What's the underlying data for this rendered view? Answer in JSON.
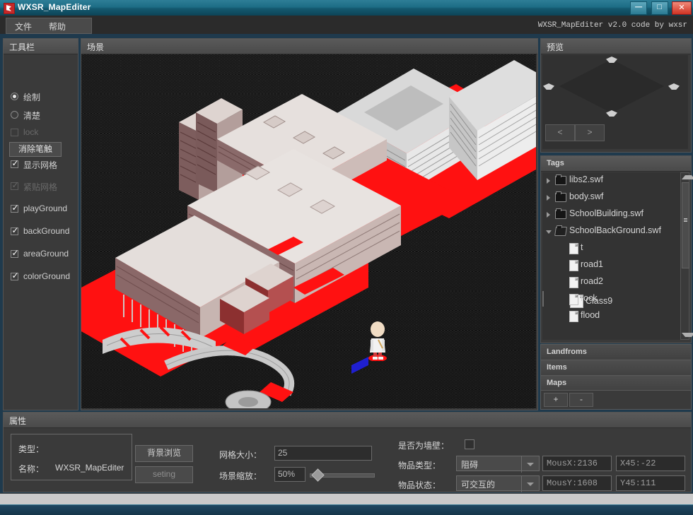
{
  "window": {
    "title": "WXSR_MapEditer",
    "icon": "app-icon",
    "minimize": "─",
    "maximize": "□",
    "close": "✕"
  },
  "menubar": {
    "file": "文件",
    "help": "帮助",
    "version_info": "WXSR_MapEditer  v2.0  code by wxsr"
  },
  "toolbar": {
    "title": "工具栏",
    "options": [
      {
        "label": "绘制",
        "type": "radio",
        "checked": true,
        "dim": false
      },
      {
        "label": "清楚",
        "type": "radio",
        "checked": false,
        "dim": false
      },
      {
        "label": "lock",
        "type": "checkbox",
        "checked": false,
        "dim": true
      }
    ],
    "clear_stroke_button": "消除笔触",
    "layers": [
      {
        "label": "显示网格",
        "checked": true,
        "dim": false
      },
      {
        "label": "紧贴网格",
        "checked": true,
        "dim": true
      },
      {
        "label": "playGround",
        "checked": true,
        "dim": false
      },
      {
        "label": "backGround",
        "checked": true,
        "dim": false
      },
      {
        "label": "areaGround",
        "checked": true,
        "dim": false
      },
      {
        "label": "colorGround",
        "checked": true,
        "dim": false
      }
    ]
  },
  "scene": {
    "title": "场景"
  },
  "preview": {
    "title": "预览",
    "prev_button": "<",
    "next_button": ">"
  },
  "tags": {
    "title": "Tags",
    "items": [
      {
        "label": "libs2.swf",
        "type": "folder",
        "expanded": false,
        "indent": 0,
        "selected": false
      },
      {
        "label": "body.swf",
        "type": "folder",
        "expanded": false,
        "indent": 0,
        "selected": false
      },
      {
        "label": "SchoolBuilding.swf",
        "type": "folder",
        "expanded": false,
        "indent": 0,
        "selected": false
      },
      {
        "label": "SchoolBackGround.swf",
        "type": "folder",
        "expanded": true,
        "indent": 0,
        "selected": false
      },
      {
        "label": "t",
        "type": "file",
        "indent": 1,
        "selected": false
      },
      {
        "label": "road1",
        "type": "file",
        "indent": 1,
        "selected": false
      },
      {
        "label": "road2",
        "type": "file",
        "indent": 1,
        "selected": false
      },
      {
        "label": "Class9",
        "type": "file",
        "indent": 1,
        "selected": true
      },
      {
        "label": "rock",
        "type": "file",
        "indent": 1,
        "selected": false
      },
      {
        "label": "flood",
        "type": "file",
        "indent": 1,
        "selected": false
      }
    ]
  },
  "accordion": {
    "landfroms": "Landfroms",
    "items": "Items",
    "maps": "Maps",
    "add_button": "+",
    "remove_button": "-"
  },
  "properties": {
    "title": "属性",
    "type_label": "类型：",
    "type_value": "",
    "name_label": "名称：",
    "name_value": "WXSR_MapEditer",
    "background_browse_button": "背景浏览",
    "setting_button": "seting",
    "grid_size_label": "网格大小：",
    "grid_size_value": "25",
    "scene_zoom_label": "场景缩放：",
    "scene_zoom_value": "50%",
    "is_wall_label": "是否为墙壁：",
    "is_wall_checked": false,
    "item_type_label": "物品类型：",
    "item_type_value": "阻碍",
    "item_state_label": "物品状态：",
    "item_state_value": "可交互的",
    "mouse_x": "MousX:2136",
    "mouse_y": "MousY:1608",
    "x45": "X45:-22",
    "y45": "Y45:111"
  },
  "colors": {
    "title_bar": "#1d6d86",
    "panel_bg": "#3a3a3a",
    "canvas_bg": "#2e2e2e",
    "selection": "#4b4b4b",
    "marker_red": "#ff1111",
    "marker_blue": "#1f1fd0"
  }
}
